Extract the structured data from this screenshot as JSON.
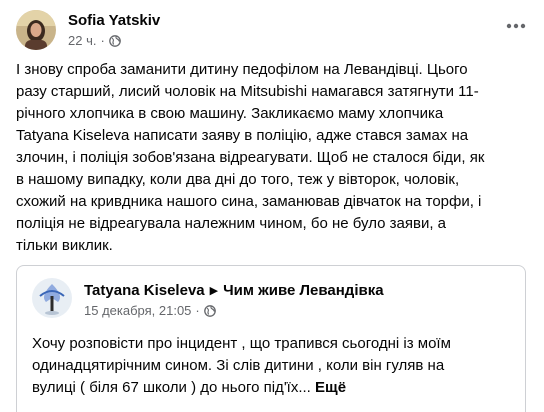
{
  "post": {
    "author": "Sofia Yatskiv",
    "time": "22 ч.",
    "meta_separator": "·",
    "privacy_icon": "globe-icon",
    "more_icon": "more-options-icon",
    "lines": [
      "І знову спроба заманити дитину педофілом на Левандівці. Цього",
      "разу старший, лисий чоловік на Mitsubishi намагався затягнути 11-",
      "річного хлопчика в свою машину. Закликаємо маму хлопчика",
      "Tatyana Kiseleva написати заяву в поліцію, адже стався замах на",
      "злочин, і поліція зобов'язана відреагувати. Щоб не сталося біди, як",
      "в нашому випадку, коли два дні до того, теж у вівторок, чоловік,",
      "схожий на кривдника нашого сина, заманював дівчаток на торфи, і",
      "поліція не відреагувала належним чином, бо не було заяви, а",
      "тільки виклик."
    ]
  },
  "shared": {
    "author": "Tatyana Kiseleva",
    "arrow": "▶",
    "group": "Чим живе Левандівка",
    "date": "15 декабря, 21:05",
    "meta_separator": "·",
    "privacy_icon": "globe-icon",
    "lines": [
      "Хочу розповісти про інцидент , що трапився сьогодні із моїм",
      "одинадцятирічним  сином. Зі слів дитини , коли він гуляв на"
    ],
    "last_line": "вулиці ( біля 67 школи ) до нього під'їх...",
    "see_more": "Ещё"
  }
}
